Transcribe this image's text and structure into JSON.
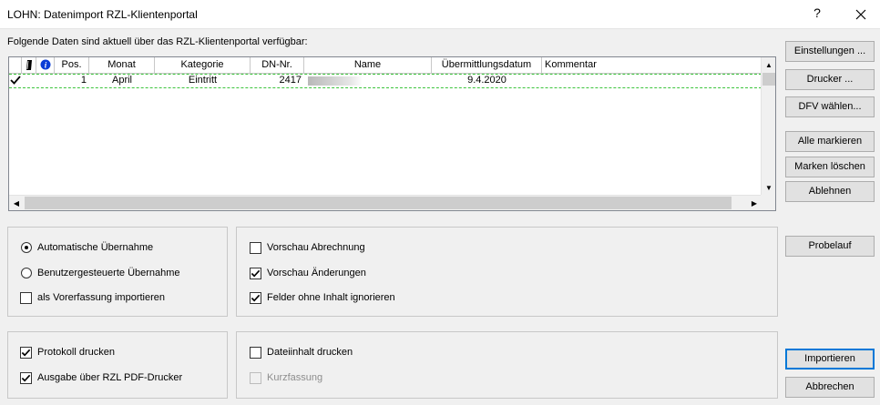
{
  "window": {
    "title": "LOHN: Datenimport RZL-Klientenportal",
    "help_label": "?"
  },
  "intro_text": "Folgende Daten sind aktuell über das RZL-Klientenportal verfügbar:",
  "table": {
    "columns": [
      "",
      "",
      "",
      "Pos.",
      "Monat",
      "Kategorie",
      "DN-Nr.",
      "Name",
      "Übermittlungsdatum",
      "Kommentar"
    ],
    "rows": [
      {
        "checked": true,
        "pos": "1",
        "monat": "April",
        "kategorie": "Eintritt",
        "dn_nr": "2417",
        "name": "",
        "datum": "9.4.2020",
        "kommentar": ""
      }
    ]
  },
  "buttons": {
    "einstellungen": "Einstellungen ...",
    "drucker": "Drucker ...",
    "dfv": "DFV wählen...",
    "alle_markieren": "Alle markieren",
    "marken_loeschen": "Marken löschen",
    "ablehnen": "Ablehnen",
    "probelauf": "Probelauf",
    "importieren": "Importieren",
    "abbrechen": "Abbrechen"
  },
  "options": {
    "auto_uebernahme": {
      "label": "Automatische Übernahme",
      "selected": true
    },
    "benutzer_uebernahme": {
      "label": "Benutzergesteuerte Übernahme",
      "selected": false
    },
    "vorerfassung": {
      "label": "als Vorerfassung importieren",
      "checked": false
    },
    "vorschau_abrechnung": {
      "label": "Vorschau Abrechnung",
      "checked": false
    },
    "vorschau_aenderungen": {
      "label": "Vorschau Änderungen",
      "checked": true
    },
    "felder_ignorieren": {
      "label": "Felder ohne Inhalt ignorieren",
      "checked": true
    },
    "protokoll_drucken": {
      "label": "Protokoll drucken",
      "checked": true
    },
    "pdf_drucker": {
      "label": "Ausgabe über RZL PDF-Drucker",
      "checked": true
    },
    "dateiinhalt_drucken": {
      "label": "Dateiinhalt drucken",
      "checked": false
    },
    "kurzfassung": {
      "label": "Kurzfassung",
      "checked": false,
      "disabled": true
    }
  },
  "colors": {
    "row_focus_border": "#3cc43c",
    "default_button_border": "#0078d7",
    "info_icon": "#0a3dd6"
  }
}
